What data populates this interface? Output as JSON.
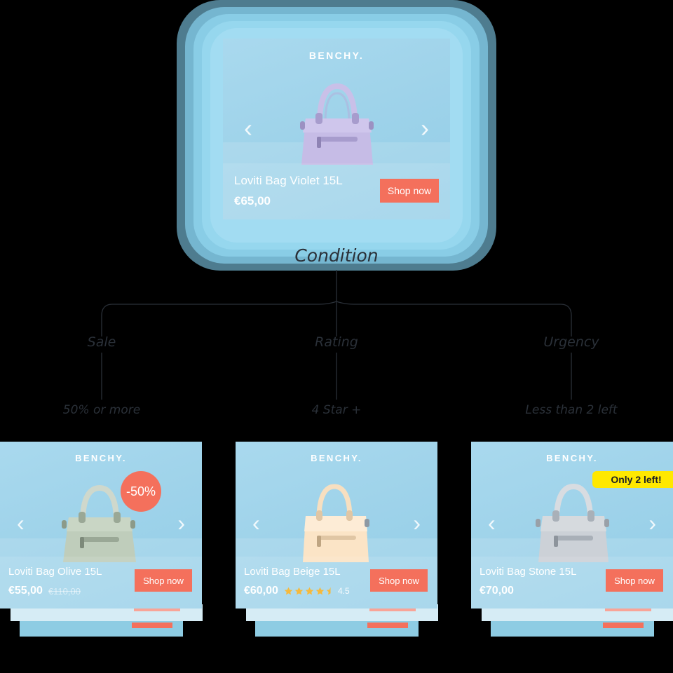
{
  "brand": "BENCHY.",
  "accent_color": "#f4705c",
  "badge_yellow": "#ffe800",
  "card_bg": "#a3d7ed",
  "line_color": "#2a3038",
  "hero": {
    "product_name": "Loviti Bag Violet 15L",
    "price": "€65,00",
    "cta": "Shop now",
    "prev_icon": "chevron-left-icon",
    "next_icon": "chevron-right-icon"
  },
  "tree": {
    "root": "Condition",
    "branches": [
      {
        "name": "Sale",
        "value": "50% or more"
      },
      {
        "name": "Rating",
        "value": "4 Star +"
      },
      {
        "name": "Urgency",
        "value": "Less than 2 left"
      }
    ]
  },
  "variants": [
    {
      "product_name": "Loviti Bag Olive 15L",
      "price": "€55,00",
      "old_price": "€110,00",
      "cta": "Shop now",
      "badge_type": "discount-circle",
      "badge_text": "-50%",
      "rating": null,
      "rating_value": null,
      "bag_color": "#b6c9b5",
      "bag_color_dark": "#9db19c"
    },
    {
      "product_name": "Loviti Bag Beige 15L",
      "price": "€60,00",
      "old_price": null,
      "cta": "Shop now",
      "badge_type": null,
      "badge_text": null,
      "rating": 4.5,
      "rating_value": "4.5",
      "bag_color": "#fbe3c4",
      "bag_color_dark": "#f0d2ad"
    },
    {
      "product_name": "Loviti Bag Stone 15L",
      "price": "€70,00",
      "old_price": null,
      "cta": "Shop now",
      "badge_type": "stock-pill",
      "badge_text": "Only 2 left!",
      "rating": null,
      "rating_value": null,
      "bag_color": "#cfd3d8",
      "bag_color_dark": "#b9bec5"
    }
  ]
}
